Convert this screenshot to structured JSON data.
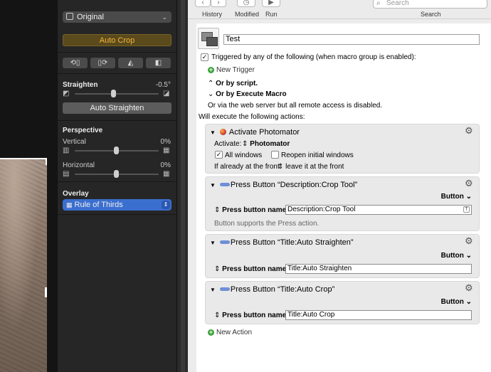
{
  "photos_panel": {
    "preset": "Original",
    "auto_crop_label": "Auto Crop",
    "transform_icons": [
      "rotate-left-icon",
      "rotate-right-icon",
      "flip-vertical-icon",
      "flip-horizontal-icon"
    ],
    "straighten": {
      "label": "Straighten",
      "value": "-0.5°",
      "level": 0.5,
      "button": "Auto Straighten"
    },
    "perspective": {
      "title": "Perspective",
      "vertical": {
        "label": "Vertical",
        "value": "0%",
        "level": 0.5
      },
      "horizontal": {
        "label": "Horizontal",
        "value": "0%",
        "level": 0.5
      }
    },
    "overlay": {
      "title": "Overlay",
      "selected": "Rule of Thirds"
    }
  },
  "toolbar": {
    "history_label": "History",
    "modified_label": "Modified",
    "run_label": "Run",
    "search_placeholder": "Search",
    "search_label": "Search"
  },
  "macro": {
    "name": "Test",
    "trigger_text": "Triggered by any of the following (when macro group is enabled):",
    "new_trigger": "New Trigger",
    "or_by_script": "Or by script.",
    "or_by_execute": "Or by Execute Macro",
    "web_server_note": "Or via the web server but all remote access is disabled.",
    "will_execute": "Will execute the following actions:",
    "new_action": "New Action"
  },
  "actions": {
    "activate": {
      "title": "Activate Photomator",
      "activate_label": "Activate:",
      "app": "Photomator",
      "all_windows_label": "All windows",
      "all_windows_checked": true,
      "reopen_label": "Reopen initial windows",
      "reopen_checked": false,
      "front_label": "If already at the front:",
      "front_value": "leave it at the front"
    },
    "press1": {
      "title": "Press Button “Description:Crop Tool”",
      "type": "Button",
      "field_label": "Press button named:",
      "field_value": "Description:Crop Tool",
      "note": "Button supports the Press action."
    },
    "press2": {
      "title": "Press Button “Title:Auto Straighten”",
      "type": "Button",
      "field_label": "Press button named:",
      "field_value": "Title:Auto Straighten"
    },
    "press3": {
      "title": "Press Button “Title:Auto Crop”",
      "type": "Button",
      "field_label": "Press button named:",
      "field_value": "Title:Auto Crop"
    }
  }
}
